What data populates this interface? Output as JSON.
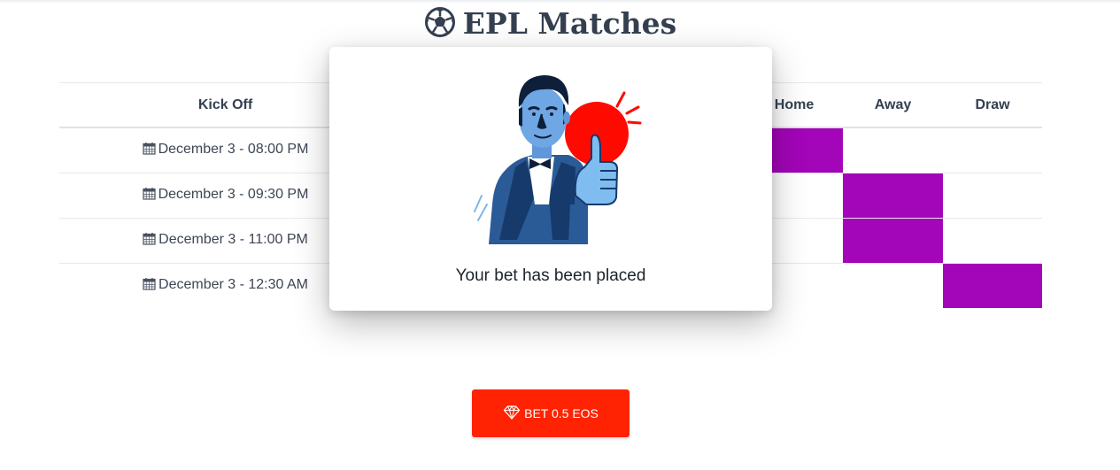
{
  "page": {
    "title": "EPL Matches",
    "icon": "soccer-ball-icon"
  },
  "table": {
    "headers": [
      "Kick Off",
      "Home",
      "Away",
      "Draw"
    ],
    "rows": [
      {
        "kickoff": "December 3 - 08:00 PM",
        "selected": "Home"
      },
      {
        "kickoff": "December 3 - 09:30 PM",
        "selected": "Away"
      },
      {
        "kickoff": "December 3 - 11:00 PM",
        "selected": "Away"
      },
      {
        "kickoff": "December 3 - 12:30 AM",
        "selected": "Draw"
      }
    ],
    "selection_color": "#a305b8"
  },
  "bet_button": {
    "label": "BET 0.5 EOS",
    "icon": "diamond-icon",
    "color": "#ff2303"
  },
  "modal": {
    "message": "Your bet has been placed",
    "illustration": "thumbs-up-man-illustration",
    "accent_color": "#ff0a00"
  }
}
